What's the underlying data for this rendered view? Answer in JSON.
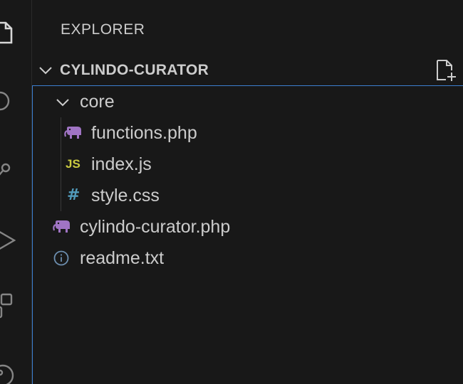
{
  "activity_bar": {
    "icons": [
      "files-icon",
      "search-icon",
      "source-control-icon",
      "run-debug-icon",
      "extensions-icon",
      "remote-icon"
    ]
  },
  "sidebar": {
    "title": "EXPLORER",
    "folder": {
      "name": "CYLINDO-CURATOR",
      "expanded": true
    },
    "tree": {
      "core_folder": {
        "label": "core",
        "expanded": true
      },
      "items": [
        {
          "label": "functions.php",
          "icon": "php-elephant-icon"
        },
        {
          "label": "index.js",
          "icon": "js-icon",
          "glyph": "JS"
        },
        {
          "label": "style.css",
          "icon": "css-hash-icon",
          "glyph": "#"
        },
        {
          "label": "cylindo-curator.php",
          "icon": "php-elephant-icon"
        },
        {
          "label": "readme.txt",
          "icon": "info-icon"
        }
      ]
    }
  },
  "colors": {
    "background": "#181818",
    "focus_border": "#3c7fd1",
    "php_icon": "#a074c4",
    "js_icon": "#cbcb41",
    "css_icon": "#519aba",
    "text": "#cccccc"
  }
}
